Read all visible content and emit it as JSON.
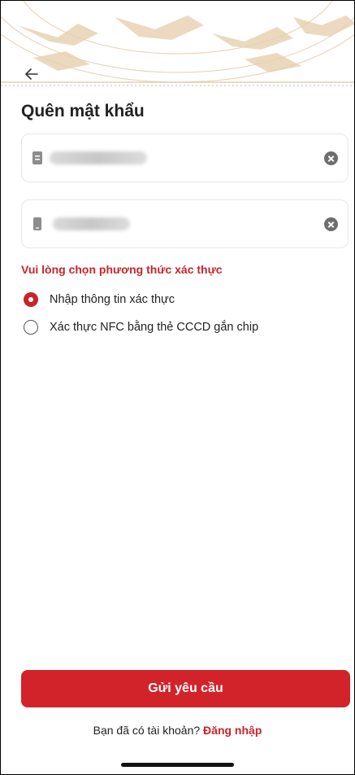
{
  "colors": {
    "accent": "#c8242b",
    "button_bg": "#d3232a",
    "header_pattern": "#d9b892"
  },
  "header": {
    "back_icon": "arrow-left-icon",
    "title": "Quên mật khẩu"
  },
  "form": {
    "fields": [
      {
        "icon": "id-card-icon",
        "value": "",
        "clear_icon": "clear-icon"
      },
      {
        "icon": "phone-icon",
        "value": "",
        "clear_icon": "clear-icon"
      }
    ],
    "method_prompt": "Vui lòng chọn phương thức xác thực",
    "methods": [
      {
        "label": "Nhập thông tin xác thực",
        "selected": true
      },
      {
        "label": "Xác thực NFC bằng thẻ CCCD gắn chip",
        "selected": false
      }
    ]
  },
  "actions": {
    "submit_label": "Gửi yêu cầu",
    "footer_text": "Bạn đã có tài khoản?",
    "login_link": "Đăng nhập"
  }
}
